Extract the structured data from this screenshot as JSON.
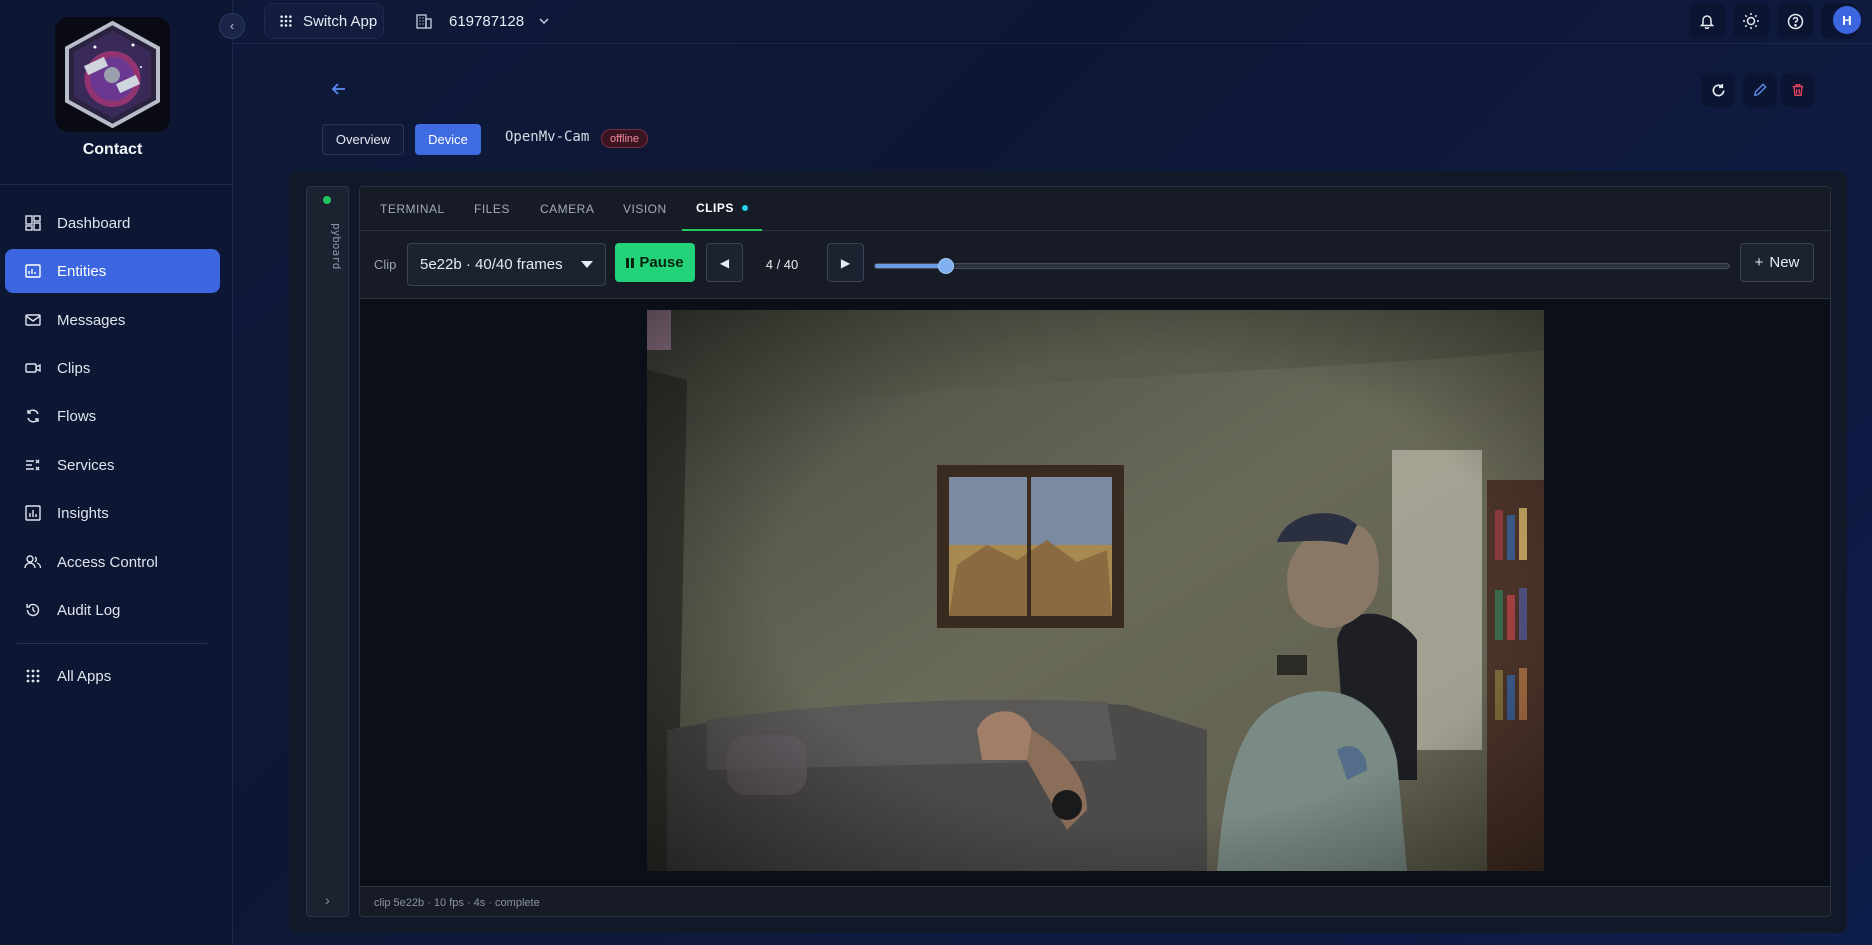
{
  "sidebar": {
    "brand": "Contact",
    "items": [
      {
        "label": "Dashboard",
        "icon": "dashboard-icon"
      },
      {
        "label": "Entities",
        "icon": "entities-icon",
        "active": true
      },
      {
        "label": "Messages",
        "icon": "mail-icon"
      },
      {
        "label": "Clips",
        "icon": "video-icon"
      },
      {
        "label": "Flows",
        "icon": "refresh-icon"
      },
      {
        "label": "Services",
        "icon": "services-icon"
      },
      {
        "label": "Insights",
        "icon": "chart-icon"
      },
      {
        "label": "Access Control",
        "icon": "users-icon"
      },
      {
        "label": "Audit Log",
        "icon": "history-icon"
      }
    ],
    "all_apps": "All Apps"
  },
  "topbar": {
    "switch_app": "Switch App",
    "org_id": "619787128",
    "avatar_initial": "H"
  },
  "device": {
    "tabs": {
      "overview": "Overview",
      "device": "Device"
    },
    "name": "OpenMv-Cam",
    "status": "offline"
  },
  "rail": {
    "label": "pyboard"
  },
  "viewer": {
    "tabs": [
      "TERMINAL",
      "FILES",
      "CAMERA",
      "VISION",
      "CLIPS"
    ],
    "active_tab": "CLIPS",
    "clip_label": "Clip",
    "clip_selected": "5e22b · 40/40 frames",
    "pause_label": "Pause",
    "frame_counter": "4 / 40",
    "progress": 0.083,
    "new_label": "New",
    "status": "clip 5e22b · 10 fps · 4s · complete"
  },
  "colors": {
    "accent": "#3b66e0",
    "success": "#22d37a",
    "danger": "#e0445c",
    "background": "#0d1733"
  }
}
